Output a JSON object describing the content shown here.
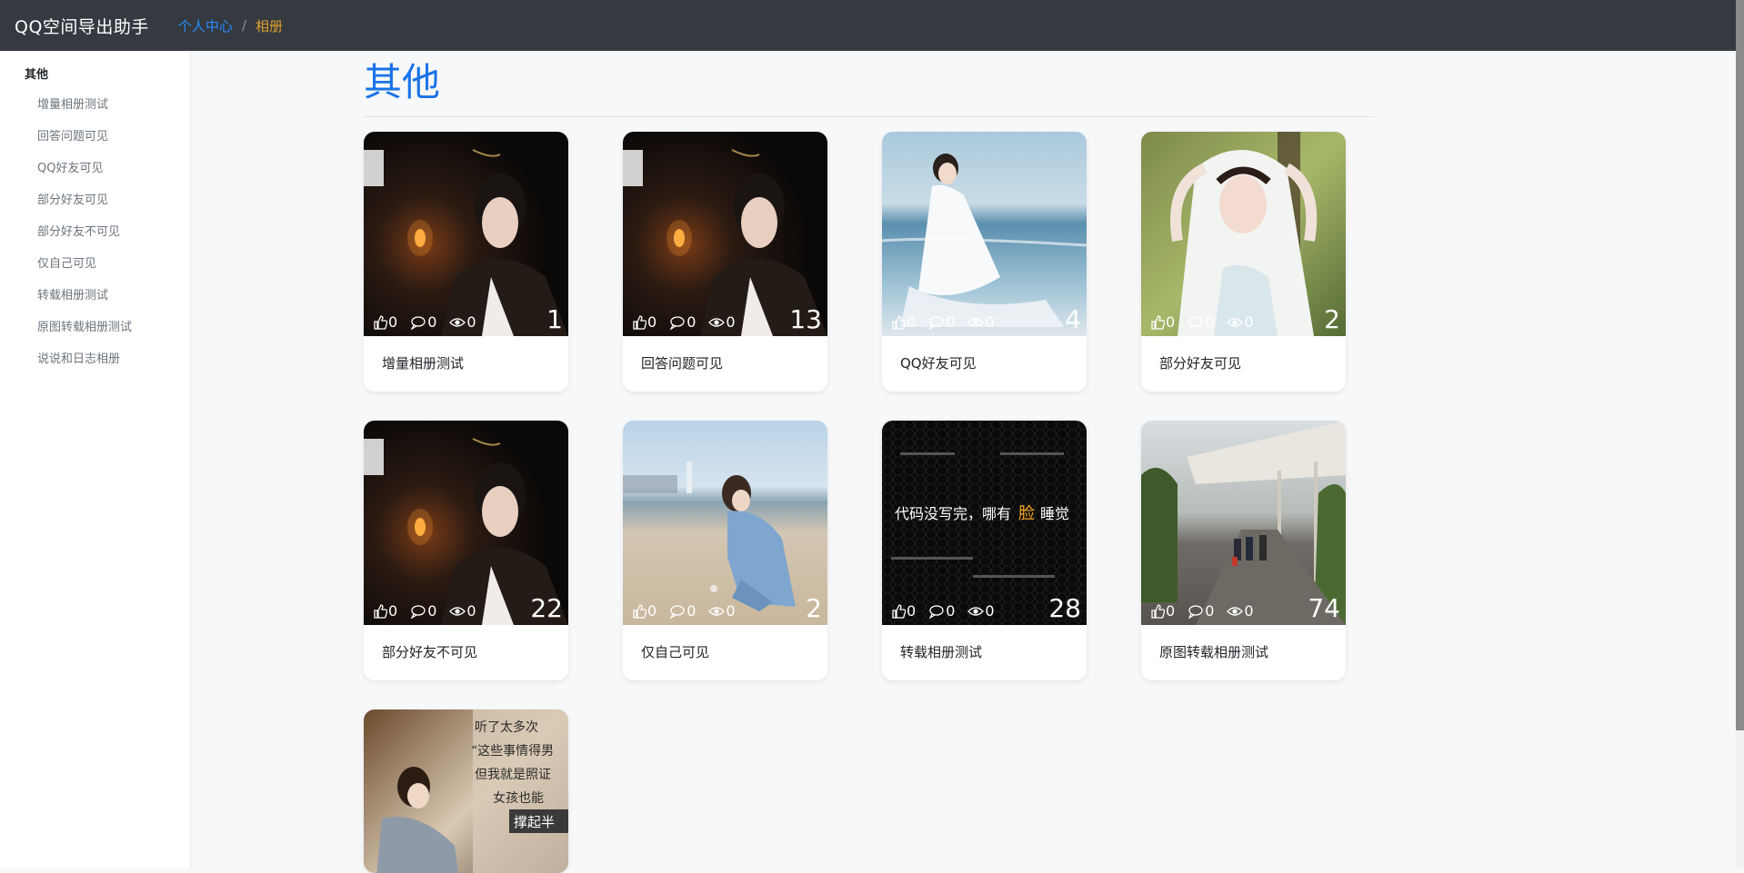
{
  "app": {
    "brand": "QQ空间导出助手"
  },
  "breadcrumb": {
    "home_label": "个人中心",
    "separator": "/",
    "current_label": "相册"
  },
  "sidebar": {
    "heading": "其他",
    "items": [
      {
        "label": "增量相册测试"
      },
      {
        "label": "回答问题可见"
      },
      {
        "label": "QQ好友可见"
      },
      {
        "label": "部分好友可见"
      },
      {
        "label": "部分好友不可见"
      },
      {
        "label": "仅自己可见"
      },
      {
        "label": "转载相册测试"
      },
      {
        "label": "原图转载相册测试"
      },
      {
        "label": "说说和日志相册"
      }
    ]
  },
  "main": {
    "title": "其他",
    "albums": [
      {
        "title": "增量相册测试",
        "likes": "0",
        "comments": "0",
        "views": "0",
        "count": "1",
        "cover": "dark-portrait"
      },
      {
        "title": "回答问题可见",
        "likes": "0",
        "comments": "0",
        "views": "0",
        "count": "13",
        "cover": "dark-portrait"
      },
      {
        "title": "QQ好友可见",
        "likes": "0",
        "comments": "0",
        "views": "0",
        "count": "4",
        "cover": "beach-white-dress"
      },
      {
        "title": "部分好友可见",
        "likes": "0",
        "comments": "0",
        "views": "0",
        "count": "2",
        "cover": "garden-veil"
      },
      {
        "title": "部分好友不可见",
        "likes": "0",
        "comments": "0",
        "views": "0",
        "count": "22",
        "cover": "dark-portrait"
      },
      {
        "title": "仅自己可见",
        "likes": "0",
        "comments": "0",
        "views": "0",
        "count": "2",
        "cover": "beach-crouching"
      },
      {
        "title": "转载相册测试",
        "likes": "0",
        "comments": "0",
        "views": "0",
        "count": "28",
        "cover": "code-text-poster",
        "cover_text": "代码没写完，哪有",
        "cover_text_highlight": "脸",
        "cover_text_tail": "睡觉"
      },
      {
        "title": "原图转载相册测试",
        "likes": "0",
        "comments": "0",
        "views": "0",
        "count": "74",
        "cover": "walkway-palms"
      },
      {
        "title": "说说和日志相册",
        "cover": "calligraphy-poster",
        "poster_lines": [
          "听了太多次",
          "“这些事情得男",
          "但我就是照证",
          "女孩也能",
          "撑起半"
        ]
      }
    ]
  },
  "colors": {
    "topbar": "#343a40",
    "brand_text": "#ffffff",
    "link": "#2b8cff",
    "current_crumb": "#e0a030",
    "title": "#1a73e8",
    "highlight_word": "#f5a623"
  }
}
